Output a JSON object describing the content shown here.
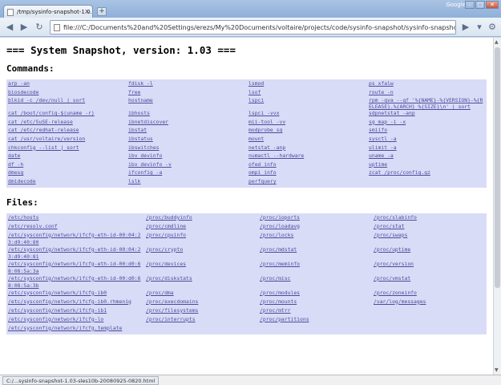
{
  "browser": {
    "tab_title": "/tmp/sysinfo-snapshot-1.0...",
    "google_label": "Google",
    "url": "file:///C:/Documents%20and%20Settings/erezs/My%20Documents/voltaire/projects/code/sysinfo-snapshot/sysinfo-snapshot-1.03-sle",
    "status_text": "C:/...sysinfo-snapshot-1.03-sles10b-20080925-0820.html"
  },
  "page": {
    "title": "=== System Snapshot, version: 1.03 ===",
    "commands_heading": "Commands:",
    "files_heading": "Files:"
  },
  "commands": [
    [
      "arp -an",
      "fdisk -l",
      "lsmod",
      "ps xfalw"
    ],
    [
      "biosdecode",
      "free",
      "lsof",
      "route -n"
    ],
    [
      "blkid -c /dev/null | sort",
      "hostname",
      "lspci",
      "rpm -qva --qf '%{NAME}-%{VERSION}-%{RELEASE}.%{ARCH} %{SIZE}\\n' | sort"
    ],
    [
      "cat /boot/config-$(uname -r)",
      "ibhosts",
      "lspci -vvx",
      "sdpnetstat -anp"
    ],
    [
      "cat /etc/SuSE-release",
      "ibnetdiscover",
      "mii-tool -vv",
      "sg_map -i -x"
    ],
    [
      "cat /etc/redhat-release",
      "ibstat",
      "modprobe sq",
      "smiifo"
    ],
    [
      "cat /usr/voltaire/version",
      "ibstatus",
      "mount",
      "sysctl -a"
    ],
    [
      "chkconfig --list | sort",
      "ibswitches",
      "netstat -anp",
      "ulimit -a"
    ],
    [
      "date",
      "ibv_devinfo",
      "numactl --hardware",
      "uname -a"
    ],
    [
      "df -h",
      "ibv_devinfo -v",
      "ofed_info",
      "uptime"
    ],
    [
      "dmesg",
      "ifconfig -a",
      "ompi_info",
      "zcat /proc/config.gz"
    ],
    [
      "dmidecode",
      "lslk",
      "perfquery",
      ""
    ]
  ],
  "files": [
    [
      "/etc/hosts",
      "/proc/buddyinfo",
      "/proc/ioports",
      "/proc/slabinfo"
    ],
    [
      "/etc/resolv.conf",
      "/proc/cmdline",
      "/proc/loadavg",
      "/proc/stat"
    ],
    [
      "/etc/sysconfig/network/ifcfg-eth-id-00:04:23:d9:40:80",
      "/proc/cpuinfo",
      "/proc/locks",
      "/proc/swaps"
    ],
    [
      "/etc/sysconfig/network/ifcfg-eth-id-00:04:23:d9:40:81",
      "/proc/crypto",
      "/proc/mdstat",
      "/proc/uptime"
    ],
    [
      "/etc/sysconfig/network/ifcfg-eth-id-00:d0:68:08:5a:3a",
      "/proc/devices",
      "/proc/meminfo",
      "/proc/version"
    ],
    [
      "/etc/sysconfig/network/ifcfg-eth-id-00:d0:68:08:5a:3b",
      "/proc/diskstats",
      "/proc/misc",
      "/proc/vmstat"
    ],
    [
      "/etc/sysconfig/network/ifcfg-ib0",
      "/proc/dma",
      "/proc/modules",
      "/proc/zoneinfo"
    ],
    [
      "/etc/sysconfig/network/ifcfg-ib0.rhmenig",
      "/proc/execdomains",
      "/proc/mounts",
      "/var/log/messages"
    ],
    [
      "/etc/sysconfig/network/ifcfg-ib1",
      "/proc/filesystems",
      "/proc/mtrr",
      ""
    ],
    [
      "/etc/sysconfig/network/ifcfg-lo",
      "/proc/interrupts",
      "/proc/partitions",
      ""
    ],
    [
      "/etc/sysconfig/network/ifcfg.template",
      "",
      "",
      ""
    ]
  ]
}
